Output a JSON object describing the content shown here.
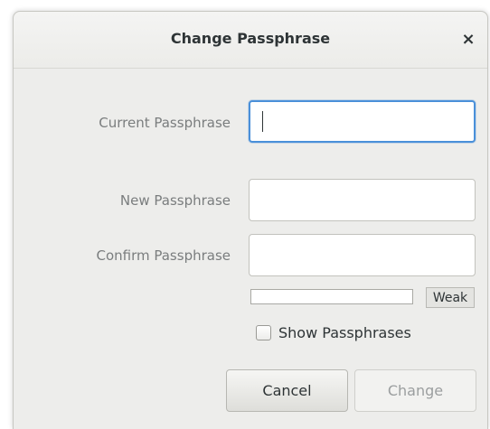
{
  "dialog": {
    "title": "Change Passphrase",
    "close_glyph": "×"
  },
  "fields": {
    "current_label": "Current Passphrase",
    "current_value": "",
    "new_label": "New Passphrase",
    "new_value": "",
    "confirm_label": "Confirm Passphrase",
    "confirm_value": ""
  },
  "strength": {
    "label": "Weak",
    "level": 0
  },
  "show_passphrases": {
    "label": "Show Passphrases",
    "checked": false
  },
  "buttons": {
    "cancel_label": "Cancel",
    "change_label": "Change",
    "change_enabled": false
  },
  "colors": {
    "focus_accent": "#4a90d9",
    "dialog_bg": "#ededeb",
    "label_text": "#7a7d7e"
  },
  "icons": {
    "close": "close-icon"
  }
}
